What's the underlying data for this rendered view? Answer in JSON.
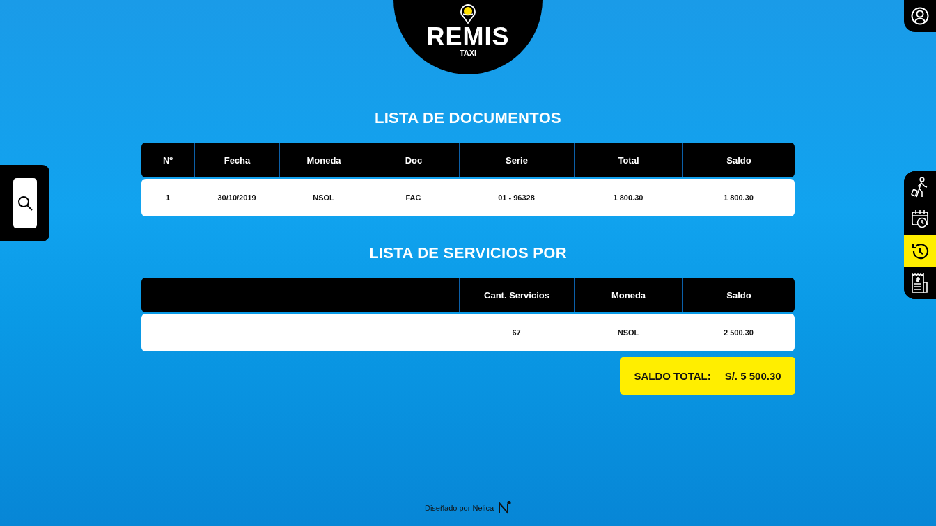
{
  "logo": {
    "title": "REMIS",
    "subtitle": "TAXI"
  },
  "nav": [
    {
      "kind": "traveler",
      "selected": false
    },
    {
      "kind": "schedule",
      "selected": false
    },
    {
      "kind": "history",
      "selected": true
    },
    {
      "kind": "receipt",
      "selected": false
    }
  ],
  "documents": {
    "title": "LISTA DE DOCUMENTOS",
    "columns": [
      "Nº",
      "Fecha",
      "Moneda",
      "Doc",
      "Serie",
      "Total",
      "Saldo"
    ],
    "rows": [
      [
        "1",
        "30/10/2019",
        "NSOL",
        "FAC",
        "01 - 96328",
        "1 800.30",
        "1 800.30"
      ]
    ]
  },
  "services": {
    "title": "LISTA DE SERVICIOS POR",
    "columns": [
      "Cant. Servicios",
      "Moneda",
      "Saldo"
    ],
    "rows": [
      [
        "67",
        "NSOL",
        "2 500.30"
      ]
    ]
  },
  "total": {
    "label": "SALDO TOTAL:",
    "value": "S/. 5 500.30"
  },
  "footer": {
    "text": "Diseñado por Nelica"
  }
}
